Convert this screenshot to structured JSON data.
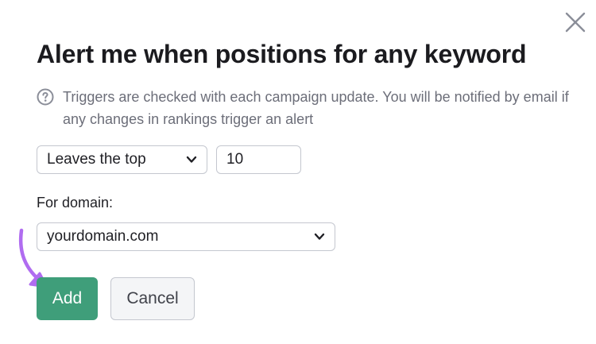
{
  "dialog": {
    "title": "Alert me when positions for any keyword",
    "info_text": "Triggers are checked with each campaign update. You will be notified by email if any changes in rankings trigger an alert",
    "condition": {
      "selected": "Leaves the top",
      "value": "10"
    },
    "domain": {
      "label": "For domain:",
      "selected": "yourdomain.com"
    },
    "buttons": {
      "add": "Add",
      "cancel": "Cancel"
    }
  },
  "icons": {
    "close": "close-icon",
    "info": "question-circle-icon",
    "chevron": "chevron-down-icon",
    "annotation": "curved-arrow-icon"
  },
  "colors": {
    "primary_button": "#3f9e7a",
    "annotation_arrow": "#b06cf0",
    "muted_text": "#6c6e79",
    "border": "#c4c7cf"
  }
}
